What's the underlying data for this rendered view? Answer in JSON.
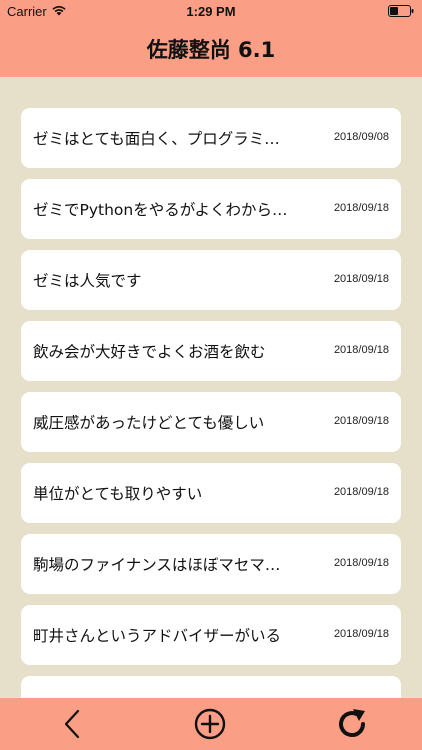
{
  "status_bar": {
    "carrier": "Carrier",
    "time": "1:29 PM"
  },
  "header": {
    "title": "佐藤整尚 6.1",
    "background": "#fa9f85"
  },
  "list": {
    "items": [
      {
        "text": "ゼミはとても面白く、プログラミ…",
        "date": "2018/09/08"
      },
      {
        "text": "ゼミでPythonをやるがよくわから…",
        "date": "2018/09/18"
      },
      {
        "text": "ゼミは人気です",
        "date": "2018/09/18"
      },
      {
        "text": "飲み会が大好きでよくお酒を飲む",
        "date": "2018/09/18"
      },
      {
        "text": "威圧感があったけどとても優しい",
        "date": "2018/09/18"
      },
      {
        "text": "単位がとても取りやすい",
        "date": "2018/09/18"
      },
      {
        "text": "駒場のファイナンスはほぼマセマ…",
        "date": "2018/09/18"
      },
      {
        "text": "町井さんというアドバイザーがいる",
        "date": "2018/09/18"
      },
      {
        "text": "",
        "date": ""
      }
    ]
  },
  "toolbar": {
    "icons": [
      "back-icon",
      "add-icon",
      "refresh-icon"
    ]
  },
  "colors": {
    "accent": "#fa9f85",
    "background": "#e6dfca",
    "card": "#ffffff"
  }
}
